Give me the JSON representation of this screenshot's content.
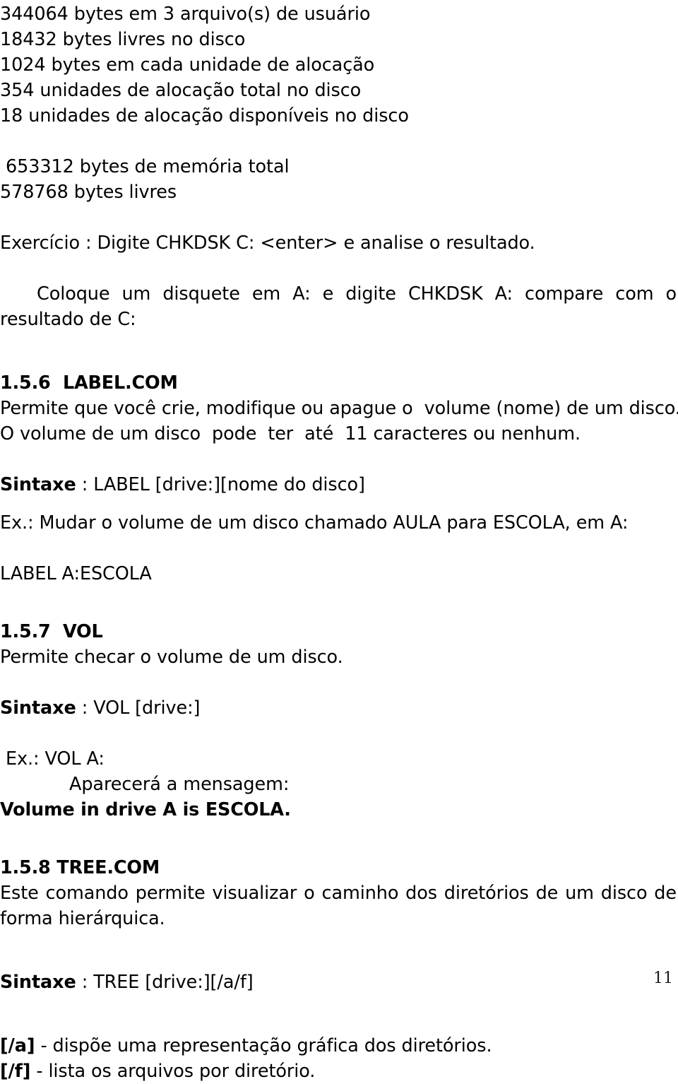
{
  "document": {
    "page_number": "11",
    "chkdsk_output": [
      "344064 bytes em 3 arquivo(s) de usuário",
      "18432 bytes livres no disco",
      "1024 bytes em cada unidade de alocação",
      "354 unidades de alocação total no disco",
      "18 unidades de alocação disponíveis no disco"
    ],
    "memory_output": [
      " 653312 bytes de memória total",
      "578768 bytes livres"
    ],
    "exercise": {
      "line": "Exercício : Digite CHKDSK C: <enter> e analise o resultado.",
      "paragraph": "Coloque um disquete em A: e digite CHKDSK A:  compare com o resultado de C:"
    },
    "sections": [
      {
        "id": "label",
        "heading": "1.5.6  LABEL.COM",
        "description_lines": [
          "Permite que você crie, modifique ou apague o  volume (nome) de um disco.",
          "O volume de um disco  pode  ter  até  11 caracteres ou nenhum."
        ],
        "syntax_label": "Sintaxe",
        "syntax_value": " : LABEL [drive:][nome do disco]",
        "example_line": "Ex.: Mudar o volume de um disco chamado AULA para ESCOLA, em A:",
        "example_command": "LABEL A:ESCOLA"
      },
      {
        "id": "vol",
        "heading": "1.5.7  VOL",
        "description_lines": [
          "Permite checar o volume de um disco."
        ],
        "syntax_label": "Sintaxe",
        "syntax_value": " : VOL [drive:]",
        "example_line": " Ex.: VOL A:",
        "example_note": "Aparecerá a mensagem:",
        "example_output": "Volume in drive A is ESCOLA."
      },
      {
        "id": "tree",
        "heading": "1.5.8 TREE.COM",
        "paragraph": "Este comando permite visualizar o caminho dos diretórios de um disco de forma hierárquica.",
        "syntax_label": "Sintaxe",
        "syntax_value": " : TREE [drive:][/a/f]",
        "switches": [
          {
            "flag": "[/a]",
            "desc": " - dispõe uma representação gráfica dos diretórios."
          },
          {
            "flag": "[/f]",
            "desc": " - lista os arquivos por diretório."
          }
        ]
      }
    ]
  }
}
